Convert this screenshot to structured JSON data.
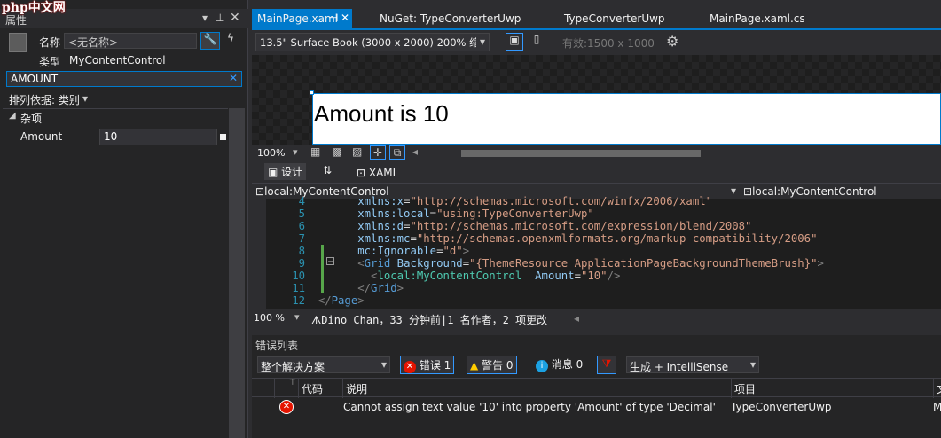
{
  "watermark": "php中文网",
  "props": {
    "title": "属性",
    "name_label": "名称",
    "name_value": "<无名称>",
    "type_label": "类型",
    "type_value": "MyContentControl",
    "search_value": "AMOUNT",
    "sort_label": "排列依据: 类别",
    "category": "杂项",
    "amount_label": "Amount",
    "amount_value": "10"
  },
  "tabs": [
    {
      "label": "MainPage.xaml"
    },
    {
      "label": "NuGet: TypeConverterUwp"
    },
    {
      "label": "TypeConverterUwp"
    },
    {
      "label": "MainPage.xaml.cs"
    }
  ],
  "device": {
    "label": "13.5\" Surface Book (3000 x 2000) 200% 缩放",
    "effective": "有效:1500 x 1000"
  },
  "canvas": {
    "text": "Amount is 10"
  },
  "zoom": "100%",
  "view_tabs": {
    "design": "设计",
    "swap": "⇅",
    "xaml": "XAML"
  },
  "scope": {
    "left": "local:MyContentControl",
    "right": "local:MyContentControl"
  },
  "code_lines": [
    {
      "n": "4",
      "html": "xmlns:x=\"http://schemas.microsoft.com/winfx/2006/xaml\""
    },
    {
      "n": "5",
      "html": "xmlns:local=\"using:TypeConverterUwp\""
    },
    {
      "n": "6",
      "html": "xmlns:d=\"http://schemas.microsoft.com/expression/blend/2008\""
    },
    {
      "n": "7",
      "html": "xmlns:mc=\"http://schemas.openxmlformats.org/markup-compatibility/2006\""
    },
    {
      "n": "8",
      "html": "mc:Ignorable=\"d\">"
    },
    {
      "n": "9",
      "html": "<Grid Background=\"{ThemeResource ApplicationPageBackgroundThemeBrush}\">"
    },
    {
      "n": "10",
      "html": "<local:MyContentControl  Amount=\"10\"/>"
    },
    {
      "n": "11",
      "html": "</Grid>"
    },
    {
      "n": "12",
      "html": "</Page>"
    }
  ],
  "status": {
    "zoom": "100 %",
    "git": "Dino Chan，33 分钟前|1 名作者，2 项更改"
  },
  "errors": {
    "title": "错误列表",
    "scope": "整个解决方案",
    "err_btn": "错误 1",
    "warn_btn": "警告 0",
    "msg_btn": "消息 0",
    "build": "生成 + IntelliSense",
    "col_code": "代码",
    "col_desc": "说明",
    "col_project": "项目",
    "col_file": "文",
    "row_desc": "Cannot assign text value '10' into property 'Amount' of type 'Decimal'",
    "row_project": "TypeConverterUwp",
    "row_file": "M"
  }
}
